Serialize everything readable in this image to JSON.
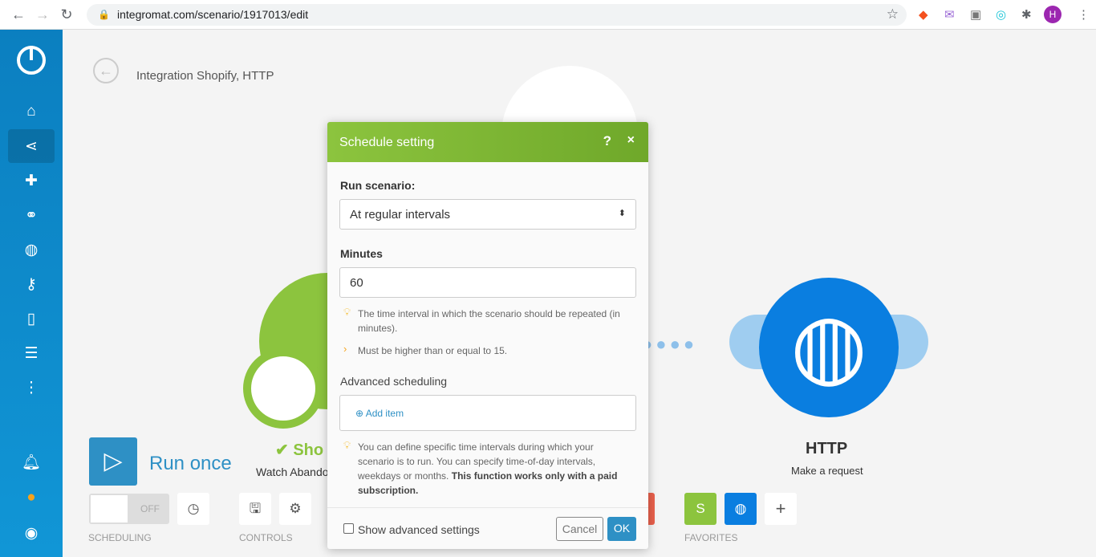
{
  "browser": {
    "url": "integromat.com/scenario/1917013/edit",
    "profile_initial": "H"
  },
  "scenario": {
    "title": "Integration Shopify, HTTP"
  },
  "modules": {
    "shopify": {
      "name": "Sho",
      "subtitle": "Watch Abando"
    },
    "http": {
      "name": "HTTP",
      "subtitle": "Make a request"
    }
  },
  "toolbar": {
    "run_once": "Run once",
    "toggle": "OFF",
    "scheduling": "SCHEDULING",
    "controls": "CONTROLS",
    "favorites": "FAVORITES",
    "add": "+"
  },
  "dialog": {
    "title": "Schedule setting",
    "help": "?",
    "close": "×",
    "run_label": "Run scenario:",
    "run_value": "At regular intervals",
    "minutes_label": "Minutes",
    "minutes_value": "60",
    "hint1": "The time interval in which the scenario should be repeated (in minutes).",
    "hint2": "Must be higher than or equal to 15.",
    "adv_label": "Advanced scheduling",
    "add_item": "Add item",
    "hint3": "You can define specific time intervals during which your scenario is to run. You can specify time-of-day intervals, weekdays or months.",
    "hint3_bold": "This function works only with a paid subscription.",
    "show_adv": "Show advanced settings",
    "cancel": "Cancel",
    "ok": "OK"
  },
  "colors": {
    "sidebar": "#0b7fc0",
    "header": "#7cb342",
    "shopify": "#8cc43e",
    "http": "#0a7ee0",
    "ok": "#2e90c5"
  }
}
